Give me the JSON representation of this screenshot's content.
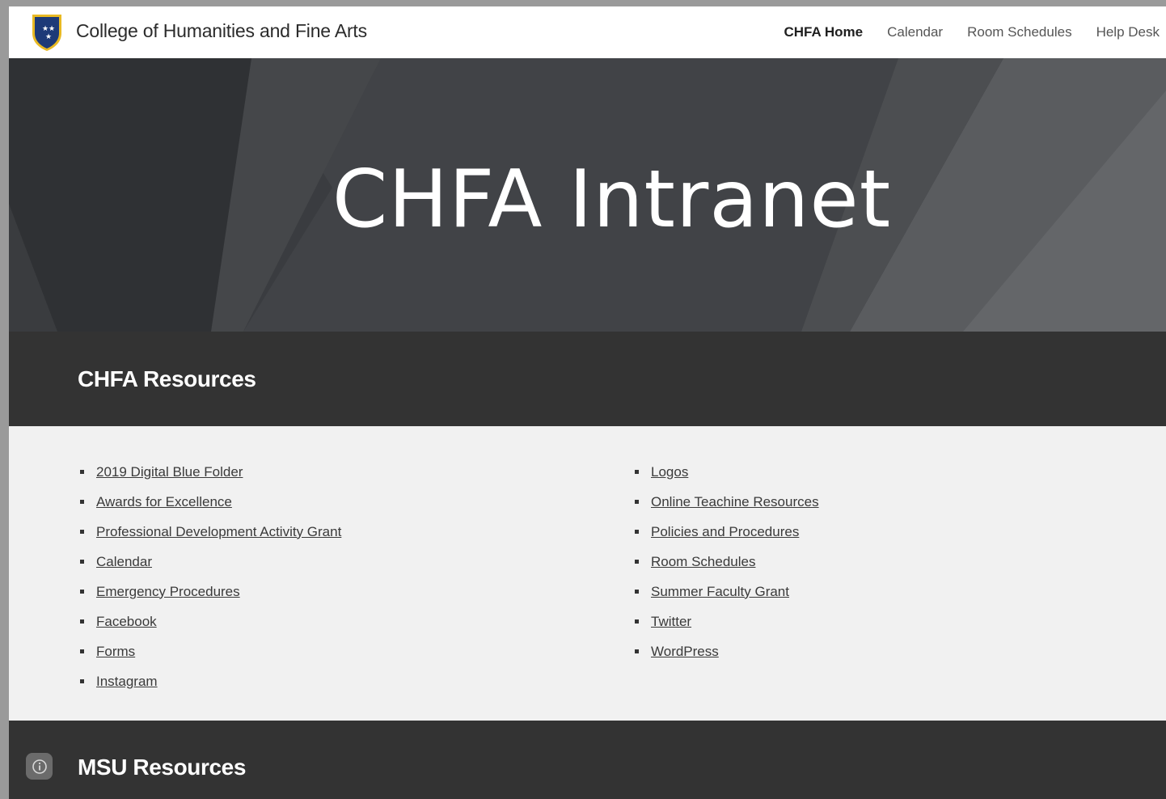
{
  "header": {
    "site_title": "College of Humanities and Fine Arts",
    "nav": [
      {
        "label": "CHFA Home",
        "active": true
      },
      {
        "label": "Calendar",
        "active": false
      },
      {
        "label": "Room Schedules",
        "active": false
      },
      {
        "label": "Help Desk",
        "active": false
      }
    ]
  },
  "hero": {
    "title": "CHFA Intranet"
  },
  "chfa_resources": {
    "heading": "CHFA Resources",
    "left_links": [
      "2019 Digital Blue Folder",
      "Awards for Excellence",
      "Professional Development Activity Grant",
      "Calendar",
      "Emergency Procedures",
      "Facebook",
      "Forms",
      "Instagram"
    ],
    "right_links": [
      "Logos",
      "Online Teachine Resources",
      "Policies and Procedures",
      "Room Schedules",
      "Summer Faculty Grant",
      "Twitter",
      "WordPress"
    ]
  },
  "msu_resources": {
    "heading": "MSU Resources"
  },
  "colors": {
    "hero_bg": "#3f4144",
    "band_bg": "#333333",
    "logo_blue": "#1d3a78",
    "logo_gold": "#e8b923"
  },
  "icons": {
    "logo": "shield-logo-icon",
    "info": "info-icon"
  }
}
